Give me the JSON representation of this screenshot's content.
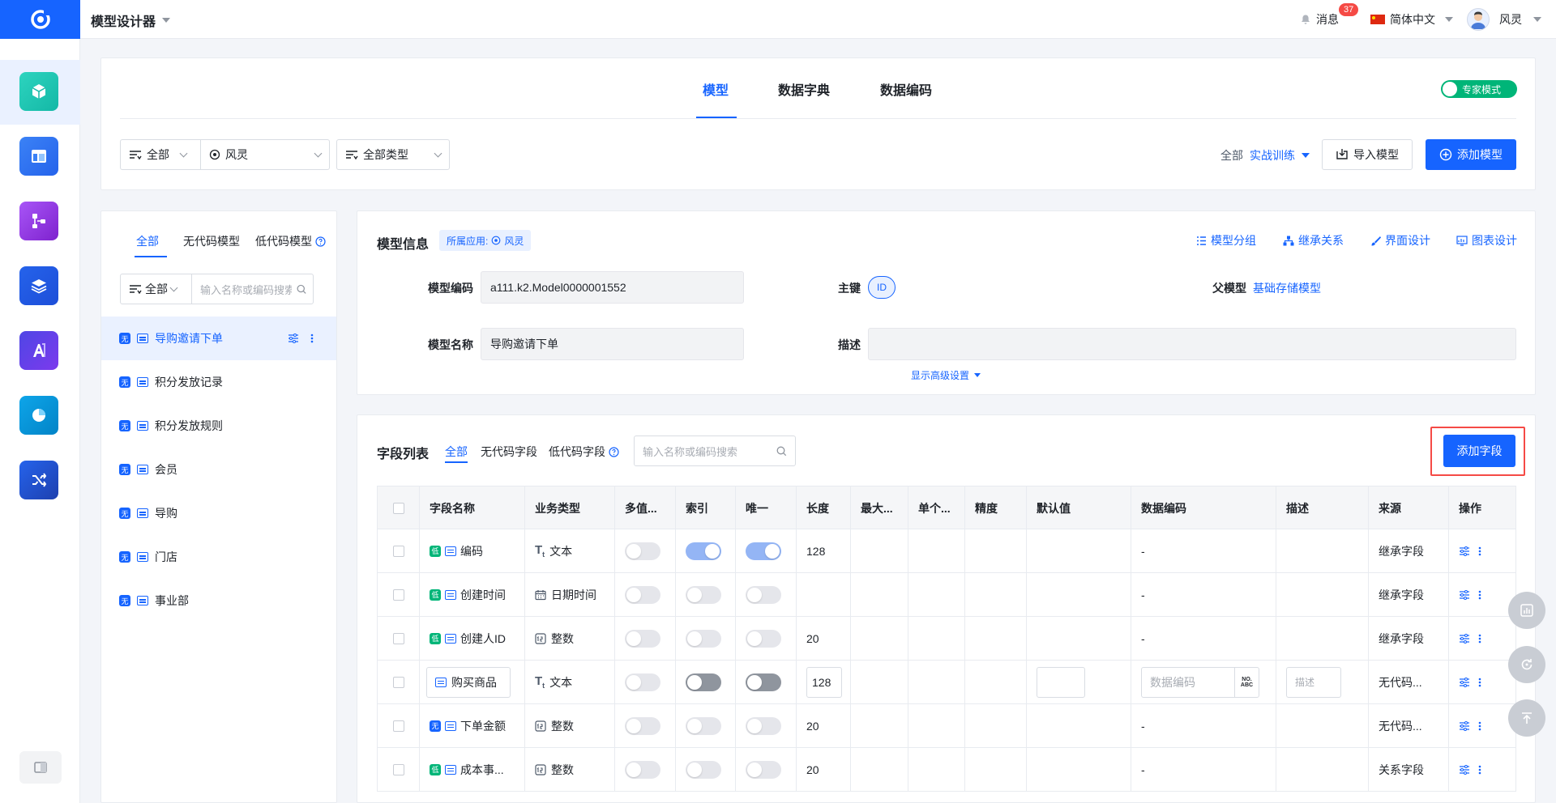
{
  "header": {
    "app_title": "模型设计器",
    "messages_label": "消息",
    "messages_count": "37",
    "language": "简体中文",
    "user_name": "风灵"
  },
  "top_tabs": [
    "模型",
    "数据字典",
    "数据编码"
  ],
  "expert_mode": "专家模式",
  "filters": {
    "scope": "全部",
    "owner": "风灵",
    "type": "全部类型",
    "app_scope_label": "全部",
    "app_scope_value": "实战训练",
    "import_button": "导入模型",
    "add_model_button": "添加模型"
  },
  "model_list": {
    "tabs": [
      "全部",
      "无代码模型",
      "低代码模型"
    ],
    "filter_scope": "全部",
    "search_placeholder": "输入名称或编码搜索",
    "items": [
      {
        "tag": "无",
        "name": "导购邀请下单"
      },
      {
        "tag": "无",
        "name": "积分发放记录"
      },
      {
        "tag": "无",
        "name": "积分发放规则"
      },
      {
        "tag": "无",
        "name": "会员"
      },
      {
        "tag": "无",
        "name": "导购"
      },
      {
        "tag": "无",
        "name": "门店"
      },
      {
        "tag": "无",
        "name": "事业部"
      }
    ]
  },
  "model_info": {
    "title": "模型信息",
    "app_tag_label": "所属应用:",
    "app_tag_value": "风灵",
    "actions": [
      "模型分组",
      "继承关系",
      "界面设计",
      "图表设计"
    ],
    "code_label": "模型编码",
    "code_value": "a111.k2.Model0000001552",
    "pk_label": "主键",
    "pk_value": "ID",
    "parent_label": "父模型",
    "parent_value": "基础存储模型",
    "name_label": "模型名称",
    "name_value": "导购邀请下单",
    "desc_label": "描述",
    "desc_value": "",
    "advanced_toggle": "显示高级设置"
  },
  "field_list": {
    "title": "字段列表",
    "tabs": [
      "全部",
      "无代码字段",
      "低代码字段"
    ],
    "search_placeholder": "输入名称或编码搜索",
    "add_field_button": "添加字段",
    "columns": [
      "字段名称",
      "业务类型",
      "多值...",
      "索引",
      "唯一",
      "长度",
      "最大...",
      "单个...",
      "精度",
      "默认值",
      "数据编码",
      "描述",
      "来源",
      "操作"
    ],
    "rows": [
      {
        "tag": "低",
        "name": "编码",
        "type_icon": "text-icon",
        "type": "文本",
        "multi": false,
        "index": true,
        "unique": true,
        "length": "128",
        "code": "-",
        "source": "继承字段"
      },
      {
        "tag": "低",
        "name": "创建时间",
        "type_icon": "calendar-icon",
        "type": "日期时间",
        "multi": false,
        "index": false,
        "unique": false,
        "length": "",
        "code": "-",
        "source": "继承字段"
      },
      {
        "tag": "低",
        "name": "创建人ID",
        "type_icon": "number-icon",
        "type": "整数",
        "multi": false,
        "index": false,
        "unique": false,
        "length": "20",
        "code": "-",
        "source": "继承字段"
      },
      {
        "tag": "",
        "name": "购买商品",
        "type_icon": "text-icon",
        "type": "文本",
        "multi": false,
        "index": false,
        "unique": false,
        "length": "128",
        "code": "",
        "source": "无代码..."
      },
      {
        "tag": "无",
        "name": "下单金额",
        "type_icon": "number-icon",
        "type": "整数",
        "multi": false,
        "index": false,
        "unique": false,
        "length": "20",
        "code": "-",
        "source": "无代码..."
      },
      {
        "tag": "低",
        "name": "成本事...",
        "type_icon": "number-icon",
        "type": "整数",
        "multi": false,
        "index": false,
        "unique": false,
        "length": "20",
        "code": "-",
        "source": "关系字段"
      }
    ],
    "edit_row": {
      "code_placeholder": "数据编码",
      "desc_placeholder": "描述"
    }
  },
  "colors": {
    "primary": "#1664ff",
    "success": "#00b578",
    "danger": "#f54a45"
  }
}
